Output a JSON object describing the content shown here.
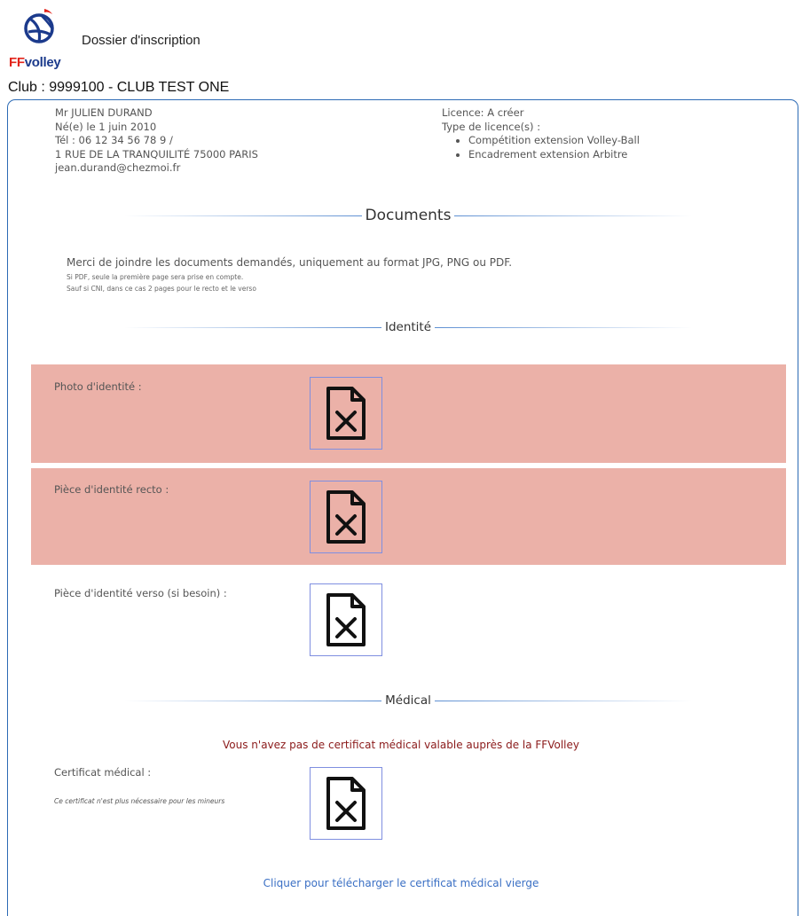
{
  "header": {
    "logo_brand_ff": "FF",
    "logo_brand_volley": "volley",
    "app_title": "Dossier d'inscription",
    "club": "Club : 9999100 - CLUB TEST ONE"
  },
  "person": {
    "name": "Mr JULIEN DURAND",
    "birth": "Né(e) le 1 juin 2010",
    "phone": "Tél : 06 12 34 56 78 9 /",
    "address": "1 RUE DE LA TRANQUILITÉ 75000 PARIS",
    "email": "jean.durand@chezmoi.fr"
  },
  "licence": {
    "status": "Licence: A créer",
    "type_label": "Type de licence(s) :",
    "types": [
      "Compétition extension Volley-Ball",
      "Encadrement extension Arbitre"
    ]
  },
  "documents": {
    "title": "Documents",
    "intro": "Merci de joindre les documents demandés, uniquement au format JPG, PNG ou PDF.",
    "note1": "Si PDF, seule la première page sera prise en compte.",
    "note2": "Sauf si CNI, dans ce cas 2 pages pour le recto et le verso"
  },
  "identite": {
    "title": "Identité",
    "rows": [
      {
        "label": "Photo d'identité :",
        "status": "missing",
        "icon": "file-missing-icon"
      },
      {
        "label": "Pièce d'identité recto :",
        "status": "missing",
        "icon": "file-missing-icon"
      },
      {
        "label": "Pièce d'identité verso (si besoin) :",
        "status": "optional",
        "icon": "file-missing-icon"
      }
    ]
  },
  "medical": {
    "title": "Médical",
    "warning": "Vous n'avez pas de certificat médical valable auprès de la FFVolley",
    "cert_label": "Certificat médical :",
    "cert_note": "Ce certificat n'est plus nécessaire pour les mineurs",
    "download_link": "Cliquer pour télécharger le certificat médical vierge"
  },
  "colors": {
    "accent": "#2d6bb5",
    "error_row": "#ebb1a8",
    "warning_text": "#8b1a1a",
    "link": "#3a6fc4"
  }
}
